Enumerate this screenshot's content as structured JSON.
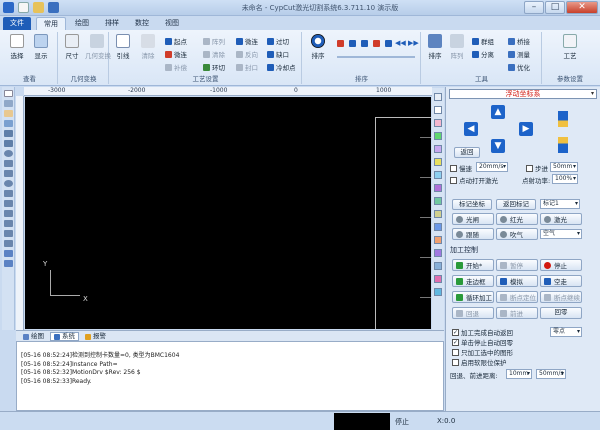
{
  "window": {
    "title": "未命名 - CypCut激光切割系统6.3.711.10 演示版"
  },
  "ribbon_tabs": [
    "文件",
    "常用",
    "绘图",
    "排样",
    "数控",
    "视图"
  ],
  "ribbon": {
    "groups": {
      "view": "查看",
      "geometry": "几何变换",
      "process": "工艺设置",
      "sort": "排序",
      "tools": "工具",
      "params": "参数设置"
    },
    "select": "选择",
    "display": "显示",
    "scale": "尺寸",
    "geometry_transform": "几何变换",
    "lead": "引线",
    "clear": "清除",
    "start_point": "起点",
    "micro_joint": "微连",
    "rev": "反向",
    "seal": "封口",
    "gap": "缺口",
    "cool_point": "冷却点",
    "compensation": "补偿",
    "ring_cut": "环切",
    "cross": "过切",
    "array": "阵列",
    "sort": "排序",
    "separate": "分离",
    "group": "群组",
    "bridge": "桥接",
    "measure": "测量",
    "optimize": "优化",
    "craft": "工艺"
  },
  "ruler": {
    "h_labels": [
      "-3000",
      "-2000",
      "-1000",
      "0",
      "1000"
    ]
  },
  "canvas": {
    "axis_x": "X",
    "axis_y": "Y"
  },
  "bottom_tabs": [
    "绘图",
    "系统",
    "报警"
  ],
  "log": [
    "[05-16 08:52:24]检测到控制卡数量=0, 类型为BMC1604",
    "[05-16 08:52:24]Instance Path=",
    "[05-16 08:52:32]MotionDrv $Rev: 256 $",
    "[05-16 08:52:33]Ready."
  ],
  "status": {
    "stop": "停止",
    "coord": "X:0.0"
  },
  "panel": {
    "mode": "浮动坐标系",
    "slow": "慢速",
    "speed1": "20mm/s",
    "step": "步进",
    "speed2": "50mm",
    "laser_on_open": "点动打开激光",
    "spot_power": "点射功率:",
    "power": "100%",
    "mark_coord": "标记坐标",
    "return_mark": "返回标记",
    "mark1": "标记1",
    "red_light": "光闸",
    "red": "红光",
    "laser": "激光",
    "follow": "跟随",
    "blow": "吹气",
    "air": "空气",
    "process_ctrl": "加工控制",
    "start": "开始*",
    "pause": "暂停",
    "stop": "停止",
    "frame": "走边框",
    "simulate": "模拟",
    "dry_run": "空走",
    "loop": "循环加工",
    "breakpoint_locate": "断点定位",
    "breakpoint_continue": "断点继续",
    "back": "回退",
    "forward": "前进",
    "home": "回零",
    "return_origin": "返回",
    "auto_return": "加工完成自动返回",
    "zero": "零点",
    "single_stop": "单击停止自动回零",
    "only_selected": "只加工选中的图形",
    "limit_protect": "启用软限位保护",
    "back_forward_dist": "回退、前进距离:",
    "dist": "10mm",
    "dist_speed": "50mm/s"
  },
  "colors": {
    "accent": "#1f5db8",
    "canvas": "#000000",
    "alert_red": "#d2180f"
  }
}
